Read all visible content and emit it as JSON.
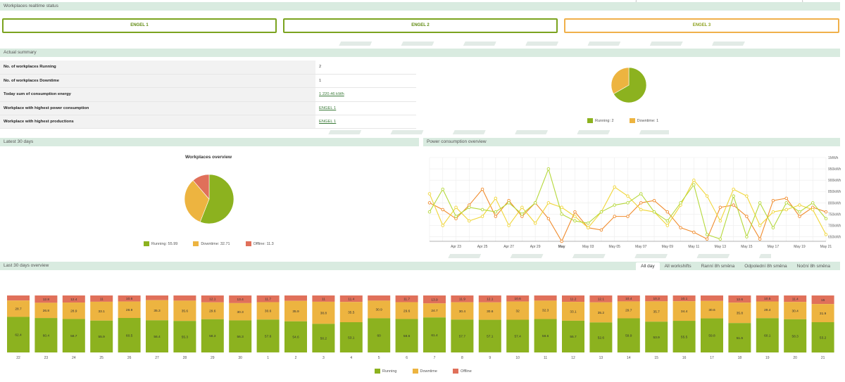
{
  "sections": {
    "realtime": "Workplaces realtime status",
    "summary": "Actual summary",
    "latest30": "Latest 30 days",
    "power": "Power consumption overview",
    "overview30": "Last 30 days overview"
  },
  "workplaces": [
    "ENGEL 1",
    "ENGEL 2",
    "ENGEL 3"
  ],
  "summary_rows": [
    {
      "label": "No. of workplaces Running",
      "value": "2"
    },
    {
      "label": "No. of workplaces Downtime",
      "value": "1"
    },
    {
      "label": "Today sum of consumption energy",
      "value": "1 220.46 kWh"
    },
    {
      "label": "Workplace with highest power consumption",
      "value": "ENGEL 1"
    },
    {
      "label": "Workplace with highest productions",
      "value": "ENGEL 1"
    }
  ],
  "colors": {
    "running": "#8cb21f",
    "downtime": "#edb440",
    "offline": "#e0705a",
    "line_orange": "#f08c2e",
    "line_yellow": "#f0d63a",
    "line_lime": "#b5d83a"
  },
  "tabs": [
    "All day",
    "All workshifts",
    "Ranní 8h směna",
    "Odpolední 8h směna",
    "Noční 8h směna"
  ],
  "chart_data": [
    {
      "type": "pie",
      "labels": [
        "Running",
        "Downtime"
      ],
      "values": [
        2,
        1
      ],
      "legend": [
        "Running: 2",
        "Downtime: 1"
      ]
    },
    {
      "type": "pie",
      "title": "Workplaces overview",
      "labels": [
        "Running",
        "Downtime",
        "Offline"
      ],
      "values": [
        55.99,
        32.71,
        11.3
      ],
      "legend": [
        "Running: 55.99",
        "Downtime: 32.71",
        "Offline: 11.3"
      ]
    },
    {
      "type": "line",
      "x": [
        "Apr 21",
        "Apr 22",
        "Apr 23",
        "Apr 24",
        "Apr 25",
        "Apr 26",
        "Apr 27",
        "Apr 28",
        "Apr 29",
        "Apr 30",
        "May 01",
        "May 02",
        "May 03",
        "May 04",
        "May 05",
        "May 06",
        "May 07",
        "May 08",
        "May 09",
        "May 10",
        "May 11",
        "May 12",
        "May 13",
        "May 14",
        "May 15",
        "May 16",
        "May 17",
        "May 18",
        "May 19",
        "May 20",
        "May 21"
      ],
      "x_tick_labels": [
        "Apr 23",
        "Apr 25",
        "Apr 27",
        "Apr 29",
        "May",
        "May 03",
        "May 05",
        "May 07",
        "May 09",
        "May 11",
        "May 13",
        "May 15",
        "May 17",
        "May 19",
        "May 21"
      ],
      "y_tick_labels": [
        "650kWh",
        "700kWh",
        "750kWh",
        "800kWh",
        "850kWh",
        "900kWh",
        "950kWh",
        "1MWh"
      ],
      "ylim": [
        630,
        1000
      ],
      "series": [
        {
          "color": "orange",
          "values": [
            800,
            770,
            730,
            790,
            860,
            740,
            810,
            740,
            800,
            730,
            630,
            760,
            690,
            680,
            740,
            740,
            800,
            810,
            760,
            690,
            670,
            640,
            780,
            790,
            740,
            640,
            810,
            820,
            740,
            780,
            760
          ]
        },
        {
          "color": "yellow",
          "values": [
            840,
            700,
            780,
            720,
            740,
            820,
            700,
            780,
            710,
            800,
            780,
            740,
            690,
            760,
            870,
            830,
            770,
            760,
            700,
            790,
            900,
            830,
            720,
            860,
            830,
            700,
            760,
            770,
            790,
            770,
            660
          ]
        },
        {
          "color": "lime",
          "values": [
            760,
            860,
            740,
            780,
            770,
            760,
            800,
            750,
            800,
            950,
            750,
            720,
            710,
            760,
            790,
            800,
            840,
            760,
            720,
            800,
            880,
            660,
            640,
            830,
            650,
            800,
            690,
            800,
            760,
            800,
            730
          ]
        }
      ]
    },
    {
      "type": "bar",
      "categories": [
        "22",
        "23",
        "24",
        "25",
        "26",
        "27",
        "28",
        "29",
        "30",
        "1",
        "2",
        "3",
        "4",
        "5",
        "6",
        "7",
        "8",
        "9",
        "10",
        "11",
        "12",
        "13",
        "14",
        "15",
        "16",
        "17",
        "18",
        "19",
        "20",
        "21"
      ],
      "series": [
        {
          "name": "Running",
          "values": [
            62.4,
            60.4,
            58.7,
            55.9,
            60.5,
            56.4,
            55.3,
            58.3,
            56.3,
            57.6,
            54.6,
            50.2,
            53.1,
            60,
            58.6,
            61.4,
            57.7,
            57.1,
            57.4,
            58.6,
            55.7,
            52.6,
            59.9,
            53.9,
            55.5,
            59.8,
            51.6,
            60.1,
            58.3,
            53.2
          ]
        },
        {
          "name": "Downtime",
          "values": [
            28.7,
            26.8,
            28.9,
            33.1,
            28.9,
            35.3,
            35.6,
            29.6,
            30.3,
            30.6,
            35.9,
            38.8,
            35.5,
            30.9,
            29.6,
            24.7,
            30.4,
            30.6,
            32,
            32.3,
            33.1,
            35.2,
            29.7,
            35.7,
            34.4,
            30.6,
            35.8,
            29.4,
            30.4,
            31.9
          ]
        },
        {
          "name": "Offline",
          "values": [
            8.9,
            12.8,
            12.4,
            11,
            10.6,
            8.3,
            9.1,
            12.1,
            13.4,
            11.7,
            9.5,
            11,
            11.4,
            9.1,
            11.7,
            13.9,
            11.9,
            12.1,
            10.6,
            9.1,
            11.2,
            12.1,
            10.4,
            10.3,
            10.1,
            9.6,
            12.6,
            10.5,
            11.4,
            15
          ]
        }
      ],
      "labels": {
        "running": [
          "62.4",
          "60.4",
          "58.7",
          "55.9",
          "60.5",
          "56.4",
          "55.3",
          "58.3",
          "56.3",
          "57.6",
          "54.6",
          "50.2",
          "53.1",
          "60",
          "58.6",
          "61.4",
          "57.7",
          "57.1",
          "57.4",
          "58.6",
          "55.7",
          "52.6",
          "59.9",
          "53.9",
          "55.5",
          "59.8",
          "51.6",
          "60.1",
          "58.3",
          "53.2"
        ],
        "downtime": [
          "28.7",
          "26.8",
          "28.9",
          "33.1",
          "28.9",
          "35.3",
          "35.6",
          "29.6",
          "30.3",
          "30.6",
          "35.9",
          "38.8",
          "35.5",
          "30.9",
          "29.6",
          "24.7",
          "30.4",
          "30.6",
          "32",
          "32.3",
          "33.1",
          "35.2",
          "29.7",
          "35.7",
          "34.4",
          "30.6",
          "35.8",
          "29.4",
          "30.4",
          "31.9"
        ],
        "offline": [
          "",
          "12.8",
          "12.4",
          "11",
          "10.6",
          "",
          "",
          "12.1",
          "13.4",
          "11.7",
          "",
          "11",
          "11.4",
          "",
          "11.7",
          "13.9",
          "11.9",
          "12.1",
          "10.6",
          "",
          "11.2",
          "12.1",
          "10.4",
          "10.3",
          "10.1",
          "",
          "12.6",
          "10.5",
          "11.4",
          "15"
        ]
      },
      "legend": [
        "Running",
        "Downtime",
        "Offline"
      ]
    }
  ]
}
